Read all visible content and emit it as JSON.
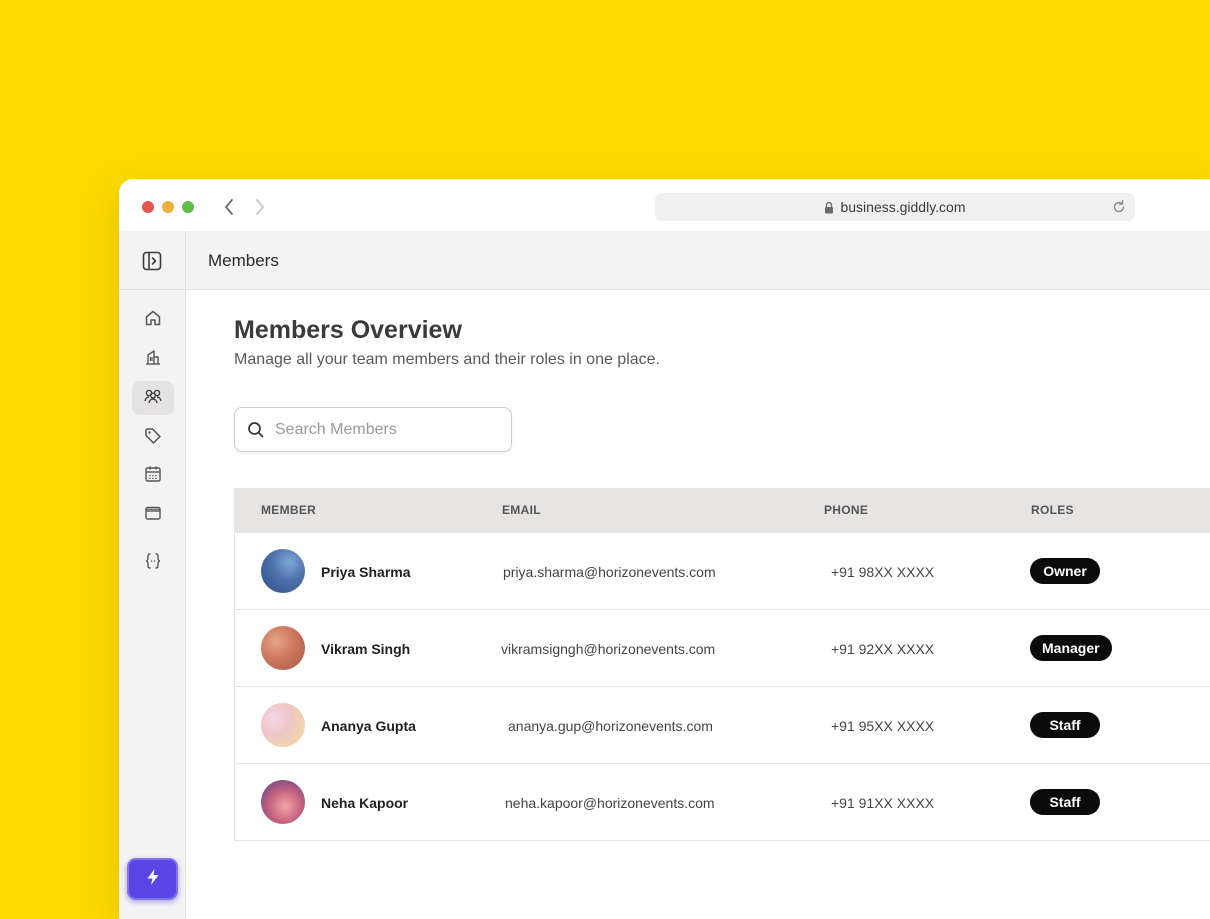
{
  "browser": {
    "url": "business.giddly.com"
  },
  "header": {
    "title": "Members"
  },
  "sidebar": {
    "items": [
      {
        "icon": "home-icon",
        "active": false
      },
      {
        "icon": "building-icon",
        "active": false
      },
      {
        "icon": "users-icon",
        "active": true
      },
      {
        "icon": "tag-icon",
        "active": false
      },
      {
        "icon": "calendar-icon",
        "active": false
      },
      {
        "icon": "wallet-icon",
        "active": false
      },
      {
        "icon": "braces-icon",
        "active": false
      }
    ],
    "action_icon": "bolt-icon"
  },
  "main": {
    "title": "Members Overview",
    "subtitle": "Manage all your team members and their roles in one place.",
    "search": {
      "placeholder": "Search Members",
      "value": ""
    }
  },
  "table": {
    "columns": [
      "MEMBER",
      "EMAIL",
      "PHONE",
      "ROLES"
    ],
    "rows": [
      {
        "name": "Priya Sharma",
        "email": "priya.sharma@horizonevents.com",
        "phone": "+91 98XX XXXX",
        "role": "Owner"
      },
      {
        "name": "Vikram Singh",
        "email": "vikramsigngh@horizonevents.com",
        "phone": "+91 92XX XXXX",
        "role": "Manager"
      },
      {
        "name": "Ananya Gupta",
        "email": "ananya.gup@horizonevents.com",
        "phone": "+91 95XX XXXX",
        "role": "Staff"
      },
      {
        "name": "Neha Kapoor",
        "email": "neha.kapoor@horizonevents.com",
        "phone": "+91 91XX XXXX",
        "role": "Staff"
      }
    ]
  },
  "colors": {
    "background": "#FFDA00",
    "accent": "#5A45E6",
    "badge": "#0B0B0B"
  }
}
